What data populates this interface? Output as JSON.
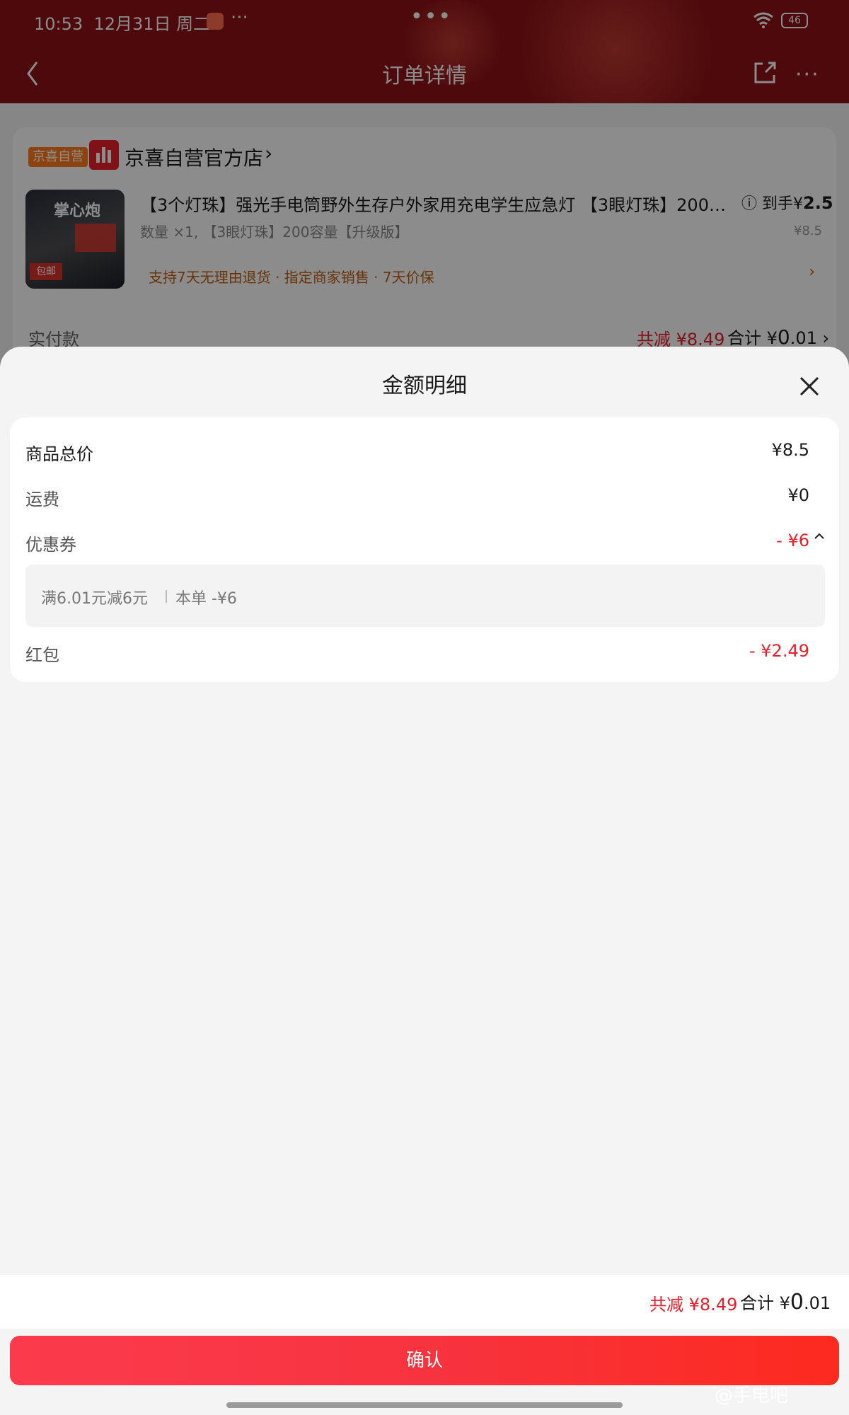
{
  "status_bar": {
    "time": "10:53",
    "date": "12月31日 周二",
    "more": "···",
    "center_dots": "•••",
    "battery": "46"
  },
  "nav": {
    "title": "订单详情",
    "more": "···"
  },
  "background_order": {
    "badge": "京喜自营",
    "store_name": "京喜自营官方店",
    "store_chevron": "›",
    "product_image_text": "掌心炮",
    "product_image_tag": "包邮",
    "product_title": "【3个灯珠】强光手电筒野外生存户外家用充电学生应急灯 【3眼灯珠】200…",
    "price_prefix": "到手¥",
    "price_value": "2.5",
    "spec": "数量 ×1, 【3眼灯珠】200容量【升级版】",
    "original_price": "¥8.5",
    "service": "支持7天无理由退货 · 指定商家销售 · 7天价保",
    "service_arrow": "›",
    "paid_label": "实付款",
    "paid_discount": "共减 ¥8.49",
    "paid_total_prefix": "合计 ¥",
    "paid_total_int": "0",
    "paid_total_dec": ".01 ›"
  },
  "sheet": {
    "title": "金额明细",
    "rows": [
      {
        "label": "商品总价",
        "value": "¥8.5"
      },
      {
        "label": "运费",
        "value": "¥0"
      },
      {
        "label": "优惠券",
        "value": "- ¥6"
      },
      {
        "label": "红包",
        "value": "- ¥2.49"
      }
    ],
    "coupon": {
      "condition": "满6.01元减6元",
      "amount": "本单 -¥6"
    },
    "total_discount": "共减 ¥8.49",
    "total_prefix": "合计 ¥",
    "total_int": "0",
    "total_dec": ".01",
    "confirm_label": "确认"
  },
  "watermark": "@手电吧",
  "colors": {
    "accent_red": "#e8202b",
    "header_bg": "#8d1116",
    "confirm_start": "#fb3b4d",
    "confirm_end": "#fd2a1f"
  }
}
